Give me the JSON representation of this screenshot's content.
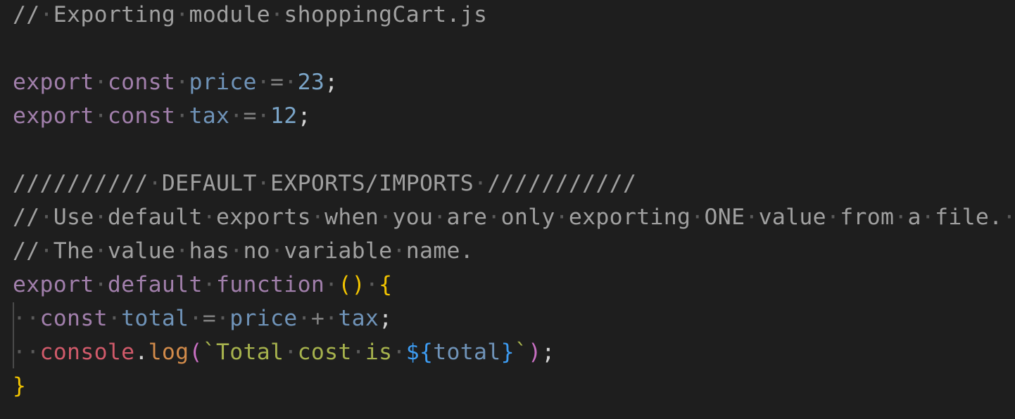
{
  "code": {
    "lines": [
      [
        {
          "t": "//",
          "c": "tok-comment"
        },
        {
          "t": "·",
          "c": "ws"
        },
        {
          "t": "Exporting",
          "c": "tok-comment"
        },
        {
          "t": "·",
          "c": "ws"
        },
        {
          "t": "module",
          "c": "tok-comment"
        },
        {
          "t": "·",
          "c": "ws"
        },
        {
          "t": "shoppingCart.js",
          "c": "tok-comment"
        }
      ],
      [],
      [
        {
          "t": "export",
          "c": "tok-keyword"
        },
        {
          "t": "·",
          "c": "ws"
        },
        {
          "t": "const",
          "c": "tok-keyword"
        },
        {
          "t": "·",
          "c": "ws"
        },
        {
          "t": "price",
          "c": "tok-var"
        },
        {
          "t": "·",
          "c": "ws"
        },
        {
          "t": "=",
          "c": "tok-op"
        },
        {
          "t": "·",
          "c": "ws"
        },
        {
          "t": "23",
          "c": "tok-number"
        },
        {
          "t": ";",
          "c": "tok-punct"
        }
      ],
      [
        {
          "t": "export",
          "c": "tok-keyword"
        },
        {
          "t": "·",
          "c": "ws"
        },
        {
          "t": "const",
          "c": "tok-keyword"
        },
        {
          "t": "·",
          "c": "ws"
        },
        {
          "t": "tax",
          "c": "tok-var"
        },
        {
          "t": "·",
          "c": "ws"
        },
        {
          "t": "=",
          "c": "tok-op"
        },
        {
          "t": "·",
          "c": "ws"
        },
        {
          "t": "12",
          "c": "tok-number"
        },
        {
          "t": ";",
          "c": "tok-punct"
        }
      ],
      [],
      [
        {
          "t": "//////////",
          "c": "tok-comment"
        },
        {
          "t": "·",
          "c": "ws"
        },
        {
          "t": "DEFAULT",
          "c": "tok-comment"
        },
        {
          "t": "·",
          "c": "ws"
        },
        {
          "t": "EXPORTS/IMPORTS",
          "c": "tok-comment"
        },
        {
          "t": "·",
          "c": "ws"
        },
        {
          "t": "///////////",
          "c": "tok-comment"
        }
      ],
      [
        {
          "t": "//",
          "c": "tok-comment"
        },
        {
          "t": "·",
          "c": "ws"
        },
        {
          "t": "Use",
          "c": "tok-comment"
        },
        {
          "t": "·",
          "c": "ws"
        },
        {
          "t": "default",
          "c": "tok-comment"
        },
        {
          "t": "·",
          "c": "ws"
        },
        {
          "t": "exports",
          "c": "tok-comment"
        },
        {
          "t": "·",
          "c": "ws"
        },
        {
          "t": "when",
          "c": "tok-comment"
        },
        {
          "t": "·",
          "c": "ws"
        },
        {
          "t": "you",
          "c": "tok-comment"
        },
        {
          "t": "·",
          "c": "ws"
        },
        {
          "t": "are",
          "c": "tok-comment"
        },
        {
          "t": "·",
          "c": "ws"
        },
        {
          "t": "only",
          "c": "tok-comment"
        },
        {
          "t": "·",
          "c": "ws"
        },
        {
          "t": "exporting",
          "c": "tok-comment"
        },
        {
          "t": "·",
          "c": "ws"
        },
        {
          "t": "ONE",
          "c": "tok-comment"
        },
        {
          "t": "·",
          "c": "ws"
        },
        {
          "t": "value",
          "c": "tok-comment"
        },
        {
          "t": "·",
          "c": "ws"
        },
        {
          "t": "from",
          "c": "tok-comment"
        },
        {
          "t": "·",
          "c": "ws"
        },
        {
          "t": "a",
          "c": "tok-comment"
        },
        {
          "t": "·",
          "c": "ws"
        },
        {
          "t": "file.",
          "c": "tok-comment"
        },
        {
          "t": "·",
          "c": "ws"
        }
      ],
      [
        {
          "t": "//",
          "c": "tok-comment"
        },
        {
          "t": "·",
          "c": "ws"
        },
        {
          "t": "The",
          "c": "tok-comment"
        },
        {
          "t": "·",
          "c": "ws"
        },
        {
          "t": "value",
          "c": "tok-comment"
        },
        {
          "t": "·",
          "c": "ws"
        },
        {
          "t": "has",
          "c": "tok-comment"
        },
        {
          "t": "·",
          "c": "ws"
        },
        {
          "t": "no",
          "c": "tok-comment"
        },
        {
          "t": "·",
          "c": "ws"
        },
        {
          "t": "variable",
          "c": "tok-comment"
        },
        {
          "t": "·",
          "c": "ws"
        },
        {
          "t": "name.",
          "c": "tok-comment"
        }
      ],
      [
        {
          "t": "export",
          "c": "tok-keyword"
        },
        {
          "t": "·",
          "c": "ws"
        },
        {
          "t": "default",
          "c": "tok-keyword"
        },
        {
          "t": "·",
          "c": "ws"
        },
        {
          "t": "function",
          "c": "tok-keyword"
        },
        {
          "t": "·",
          "c": "ws"
        },
        {
          "t": "()",
          "c": "tok-brace"
        },
        {
          "t": "·",
          "c": "ws"
        },
        {
          "t": "{",
          "c": "tok-brace"
        }
      ],
      [
        {
          "t": "··",
          "c": "ws"
        },
        {
          "t": "const",
          "c": "tok-keyword"
        },
        {
          "t": "·",
          "c": "ws"
        },
        {
          "t": "total",
          "c": "tok-var"
        },
        {
          "t": "·",
          "c": "ws"
        },
        {
          "t": "=",
          "c": "tok-op"
        },
        {
          "t": "·",
          "c": "ws"
        },
        {
          "t": "price",
          "c": "tok-var"
        },
        {
          "t": "·",
          "c": "ws"
        },
        {
          "t": "+",
          "c": "tok-op"
        },
        {
          "t": "·",
          "c": "ws"
        },
        {
          "t": "tax",
          "c": "tok-var"
        },
        {
          "t": ";",
          "c": "tok-punct"
        }
      ],
      [
        {
          "t": "··",
          "c": "ws"
        },
        {
          "t": "console",
          "c": "tok-builtin"
        },
        {
          "t": ".",
          "c": "tok-punct"
        },
        {
          "t": "log",
          "c": "tok-method"
        },
        {
          "t": "(",
          "c": "tok-paren2"
        },
        {
          "t": "`Total",
          "c": "tok-string"
        },
        {
          "t": "·",
          "c": "ws"
        },
        {
          "t": "cost",
          "c": "tok-string"
        },
        {
          "t": "·",
          "c": "ws"
        },
        {
          "t": "is",
          "c": "tok-string"
        },
        {
          "t": "·",
          "c": "ws"
        },
        {
          "t": "${",
          "c": "tok-interp"
        },
        {
          "t": "total",
          "c": "tok-var"
        },
        {
          "t": "}",
          "c": "tok-interp"
        },
        {
          "t": "`",
          "c": "tok-string"
        },
        {
          "t": ")",
          "c": "tok-paren2"
        },
        {
          "t": ";",
          "c": "tok-punct"
        }
      ],
      [
        {
          "t": "}",
          "c": "tok-brace"
        }
      ]
    ]
  },
  "colors": {
    "background": "#1e1e1e",
    "comment": "#a0a0a0",
    "keyword": "#a17fab",
    "variable": "#6f93b8",
    "number": "#7aa4c7",
    "brace": "#f2c400",
    "string": "#a6b24d",
    "builtin": "#d05a6a",
    "method": "#d28b4a",
    "interpolation": "#3d9bf0",
    "whitespace_marker": "#5a5a5a"
  }
}
